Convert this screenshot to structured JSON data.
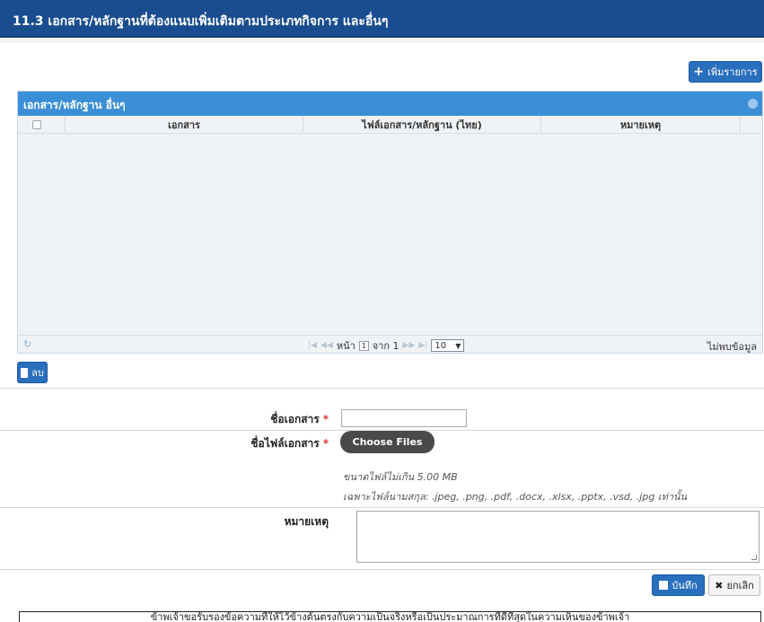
{
  "header": {
    "title": "11.3 เอกสาร/หลักฐานที่ต้องแนบเพิ่มเติมตามประเภทกิจการ และอื่นๆ"
  },
  "toolbar": {
    "add_label": "เพิ่มรายการ",
    "delete_label": "ลบ"
  },
  "grid": {
    "title": "เอกสาร/หลักฐาน อื่นๆ",
    "columns": [
      "เอกสาร",
      "ไฟล์เอกสาร/หลักฐาน (ไทย)",
      "หมายเหตุ"
    ],
    "pager": {
      "page_label": "หน้า",
      "page_value": "1",
      "of_label": "จาก 1",
      "page_size": "10"
    },
    "empty_text": "ไม่พบข้อมูล"
  },
  "form": {
    "doc_name_label": "ชื่อเอกสาร",
    "file_name_label": "ชื่อไฟล์เอกสาร",
    "choose_files_label": "Choose Files",
    "size_hint": "ขนาดไฟล์ไม่เกิน 5.00 MB",
    "ext_hint": "เฉพาะไฟล์นามสกุล: .jpeg, .png, .pdf, .docx, .xlsx, .pptx, .vsd, .jpg เท่านั้น",
    "note_label": "หมายเหตุ",
    "required_marker": "*"
  },
  "actions": {
    "save_label": "บันทึก",
    "cancel_label": "ยกเลิก"
  },
  "certification": {
    "text": "ข้าพเจ้าขอรับรองข้อความที่ให้ไว้ข้างต้นตรงกับความเป็นจริงหรือเป็นประมาณการที่ดีที่สุดในความเห็นของข้าพเจ้า"
  },
  "colors": {
    "header": "#1a4d8f",
    "grid_title": "#3a8fd6",
    "button": "#2a6fbd",
    "required": "#e53935"
  },
  "icons": {
    "add": "plus-icon",
    "delete": "trash-icon",
    "save": "floppy-icon",
    "cancel": "x-icon",
    "refresh": "refresh-icon",
    "collapse": "collapse-icon"
  }
}
